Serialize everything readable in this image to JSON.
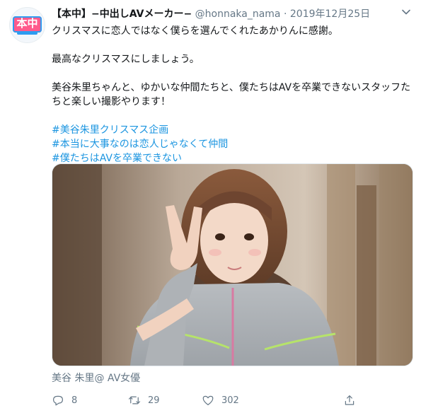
{
  "tweet": {
    "avatar_text": "本中",
    "display_name": "【本中】−中出しAVメーカー−",
    "handle": "@honnaka_nama",
    "separator": "·",
    "date": "2019年12月25日",
    "lines": [
      "クリスマスに恋人ではなく僕らを選んでくれたあかりんに感謝。",
      "最高なクリスマスにしましょう。",
      "美谷朱里ちゃんと、ゆかいな仲間たちと、僕たちはAVを卒業できないスタッフたちと楽しい撮影やります！"
    ],
    "hashtags": [
      "#美谷朱里クリスマス企画",
      "#本当に大事なのは恋人じゃなくて仲間",
      "#僕たちはAVを卒業できない"
    ],
    "media_caption": "美谷 朱里@ AV女優"
  },
  "actions": {
    "reply_count": "8",
    "retweet_count": "29",
    "like_count": "302",
    "share_count": ""
  },
  "colors": {
    "link": "#1b95e0",
    "muted": "#657786",
    "brand_pink": "#ff5a8c",
    "brand_blue": "#2e9cf0"
  },
  "icons": [
    "chevron-down-icon",
    "reply-icon",
    "retweet-icon",
    "heart-icon",
    "share-icon"
  ]
}
